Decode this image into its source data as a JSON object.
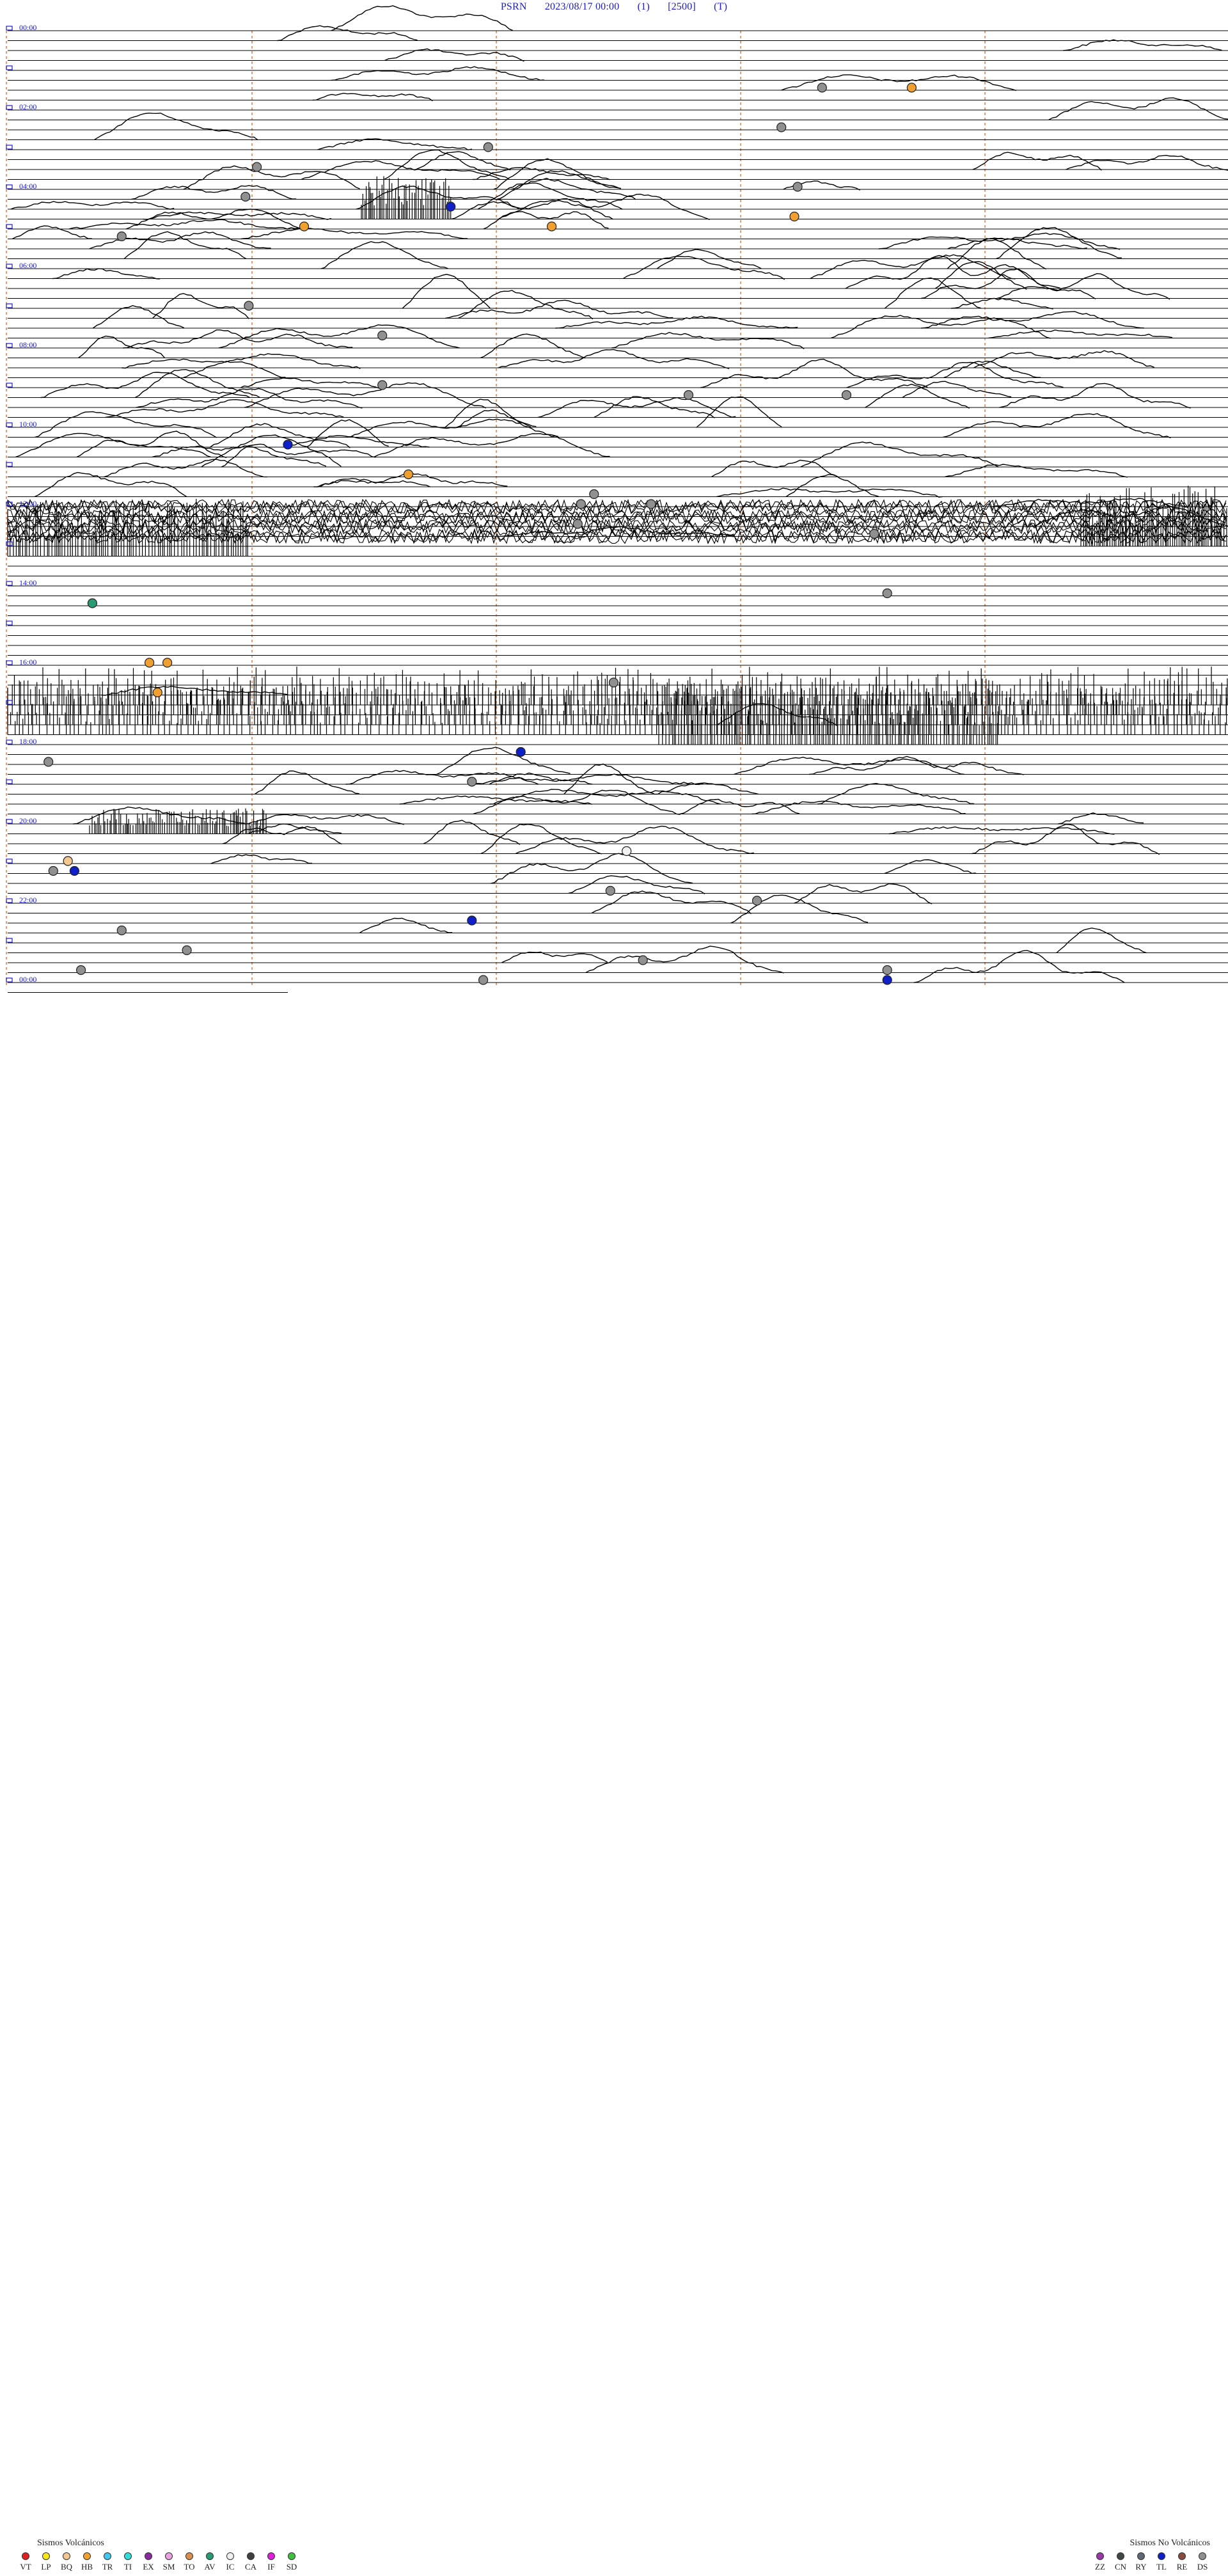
{
  "header": {
    "station": "PSRN",
    "datetime": "2023/08/17 00:00",
    "gain": "(1)",
    "scale": "[2500]",
    "mode": "(T)"
  },
  "chart_data": {
    "type": "helicorder",
    "station": "PSRN",
    "date": "2023/08/17",
    "rows_per_hour": 4,
    "hour_labels": [
      "00:00",
      "02:00",
      "04:00",
      "06:00",
      "08:00",
      "10:00",
      "12:00",
      "14:00",
      "16:00",
      "18:00",
      "20:00",
      "22:00",
      "00:00"
    ],
    "minute_marks": 5,
    "events": [
      {
        "hour": 1.45,
        "minute": 50.0,
        "type": "DS"
      },
      {
        "hour": 1.6,
        "minute": 55.5,
        "type": "HB"
      },
      {
        "hour": 2.62,
        "minute": 47.5,
        "type": "DS"
      },
      {
        "hour": 3.1,
        "minute": 29.5,
        "type": "DS"
      },
      {
        "hour": 3.52,
        "minute": 15.3,
        "type": "DS"
      },
      {
        "hour": 4.05,
        "minute": 48.5,
        "type": "DS"
      },
      {
        "hour": 4.37,
        "minute": 14.6,
        "type": "DS"
      },
      {
        "hour": 4.6,
        "minute": 27.2,
        "type": "TL"
      },
      {
        "hour": 4.85,
        "minute": 48.3,
        "type": "HB"
      },
      {
        "hour": 5.0,
        "minute": 18.2,
        "type": "HB"
      },
      {
        "hour": 5.05,
        "minute": 33.4,
        "type": "HB"
      },
      {
        "hour": 5.15,
        "minute": 7.0,
        "type": "DS"
      },
      {
        "hour": 6.95,
        "minute": 14.8,
        "type": "DS"
      },
      {
        "hour": 7.75,
        "minute": 23.0,
        "type": "DS"
      },
      {
        "hour": 9.1,
        "minute": 23.0,
        "type": "DS"
      },
      {
        "hour": 9.25,
        "minute": 41.8,
        "type": "DS"
      },
      {
        "hour": 9.2,
        "minute": 51.5,
        "type": "DS"
      },
      {
        "hour": 10.52,
        "minute": 17.2,
        "type": "TL"
      },
      {
        "hour": 11.3,
        "minute": 24.6,
        "type": "HB"
      },
      {
        "hour": 11.72,
        "minute": 36.0,
        "type": "DS"
      },
      {
        "hour": 11.92,
        "minute": 35.2,
        "type": "DS"
      },
      {
        "hour": 12.0,
        "minute": 39.5,
        "type": "DS"
      },
      {
        "hour": 12.5,
        "minute": 35.0,
        "type": "DS"
      },
      {
        "hour": 12.7,
        "minute": 53.2,
        "type": "DS"
      },
      {
        "hour": 14.28,
        "minute": 54.0,
        "type": "DS"
      },
      {
        "hour": 14.6,
        "minute": 5.2,
        "type": "AV"
      },
      {
        "hour": 15.97,
        "minute": 9.8,
        "type": "HB"
      },
      {
        "hour": 15.92,
        "minute": 8.7,
        "type": "HB"
      },
      {
        "hour": 16.62,
        "minute": 37.2,
        "type": "DS"
      },
      {
        "hour": 16.85,
        "minute": 9.2,
        "type": "HB"
      },
      {
        "hour": 18.2,
        "minute": 31.5,
        "type": "TL"
      },
      {
        "hour": 18.5,
        "minute": 2.5,
        "type": "DS"
      },
      {
        "hour": 19.05,
        "minute": 28.5,
        "type": "DS"
      },
      {
        "hour": 20.8,
        "minute": 38.0,
        "type": "IC"
      },
      {
        "hour": 21.0,
        "minute": 3.7,
        "type": "BQ"
      },
      {
        "hour": 21.2,
        "minute": 4.1,
        "type": "TL"
      },
      {
        "hour": 21.3,
        "minute": 2.8,
        "type": "DS"
      },
      {
        "hour": 21.8,
        "minute": 37.0,
        "type": "DS"
      },
      {
        "hour": 22.05,
        "minute": 46.0,
        "type": "DS"
      },
      {
        "hour": 22.4,
        "minute": 28.5,
        "type": "TL"
      },
      {
        "hour": 22.75,
        "minute": 7.0,
        "type": "DS"
      },
      {
        "hour": 23.35,
        "minute": 11.0,
        "type": "DS"
      },
      {
        "hour": 23.5,
        "minute": 39.0,
        "type": "DS"
      },
      {
        "hour": 23.8,
        "minute": 4.5,
        "type": "DS"
      },
      {
        "hour": 23.92,
        "minute": 29.2,
        "type": "DS"
      },
      {
        "hour": 23.85,
        "minute": 54.0,
        "type": "DS"
      },
      {
        "hour": 24.0,
        "minute": 54.0,
        "type": "TL"
      }
    ]
  },
  "legend": {
    "volcanic_title": "Sismos Volcánicos",
    "nonvolcanic_title": "Sismos No Volcánicos",
    "volcanic": [
      {
        "label": "VT",
        "color": "#e02020"
      },
      {
        "label": "LP",
        "color": "#f5e81a"
      },
      {
        "label": "BQ",
        "color": "#f2c890"
      },
      {
        "label": "HB",
        "color": "#f0a030"
      },
      {
        "label": "TR",
        "color": "#40c8f0"
      },
      {
        "label": "TI",
        "color": "#30e0d8"
      },
      {
        "label": "EX",
        "color": "#8a2aa0"
      },
      {
        "label": "SM",
        "color": "#e8a0e0"
      },
      {
        "label": "TO",
        "color": "#d89050"
      },
      {
        "label": "AV",
        "color": "#2a9a70"
      },
      {
        "label": "IC",
        "color": "#f0f0f0"
      },
      {
        "label": "CA",
        "color": "#404040"
      },
      {
        "label": "IF",
        "color": "#e020d8"
      },
      {
        "label": "SD",
        "color": "#40c040"
      }
    ],
    "nonvolcanic": [
      {
        "label": "ZZ",
        "color": "#9a3aa8"
      },
      {
        "label": "CN",
        "color": "#404848"
      },
      {
        "label": "RY",
        "color": "#606878"
      },
      {
        "label": "TL",
        "color": "#1020c8"
      },
      {
        "label": "RE",
        "color": "#8a4a40"
      },
      {
        "label": "DS",
        "color": "#909090"
      }
    ]
  },
  "colors": {
    "trace": "#000000",
    "baseline": "#000000",
    "minute_marker": "#e07030",
    "hour_label": "#1a1ad0"
  }
}
